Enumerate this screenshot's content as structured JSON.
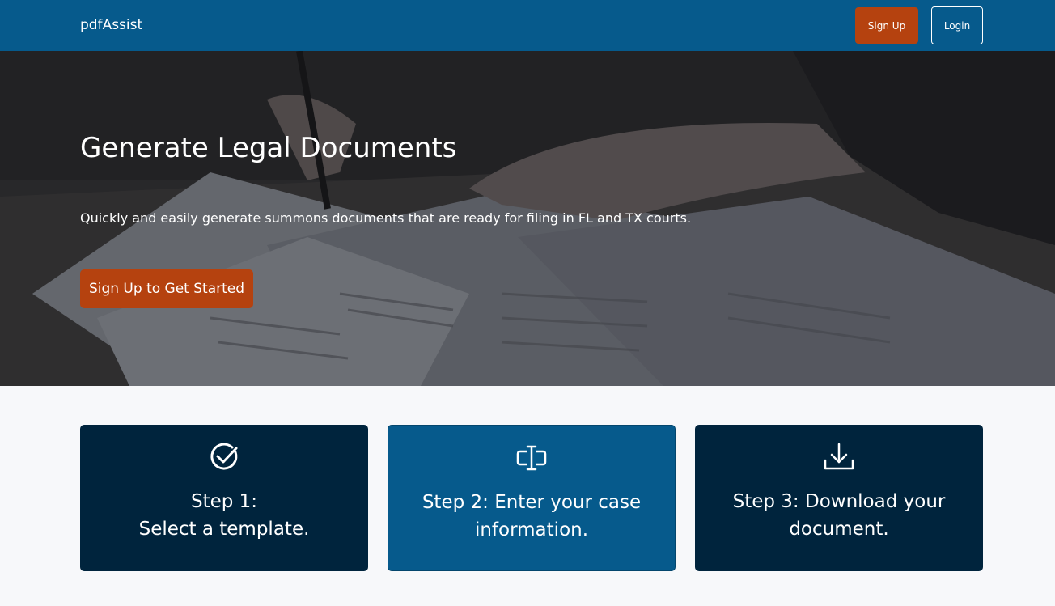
{
  "navbar": {
    "brand": "pdfAssist",
    "signup_label": "Sign Up",
    "login_label": "Login"
  },
  "hero": {
    "title": "Generate Legal Documents",
    "subtitle": "Quickly and easily generate summons documents that are ready for filing in FL and TX courts.",
    "cta_label": "Sign Up to Get Started"
  },
  "steps": [
    {
      "icon": "check-circle-icon",
      "label": "Step 1:\nSelect a template."
    },
    {
      "icon": "text-cursor-input-icon",
      "label": "Step 2: Enter your case information."
    },
    {
      "icon": "download-icon",
      "label": "Step 3: Download your document."
    }
  ],
  "colors": {
    "navbar": "#065a8c",
    "accent": "#b5420f",
    "card_dark": "#00243d",
    "card_mid": "#065a8c",
    "page_bg": "#f7f8fa"
  }
}
